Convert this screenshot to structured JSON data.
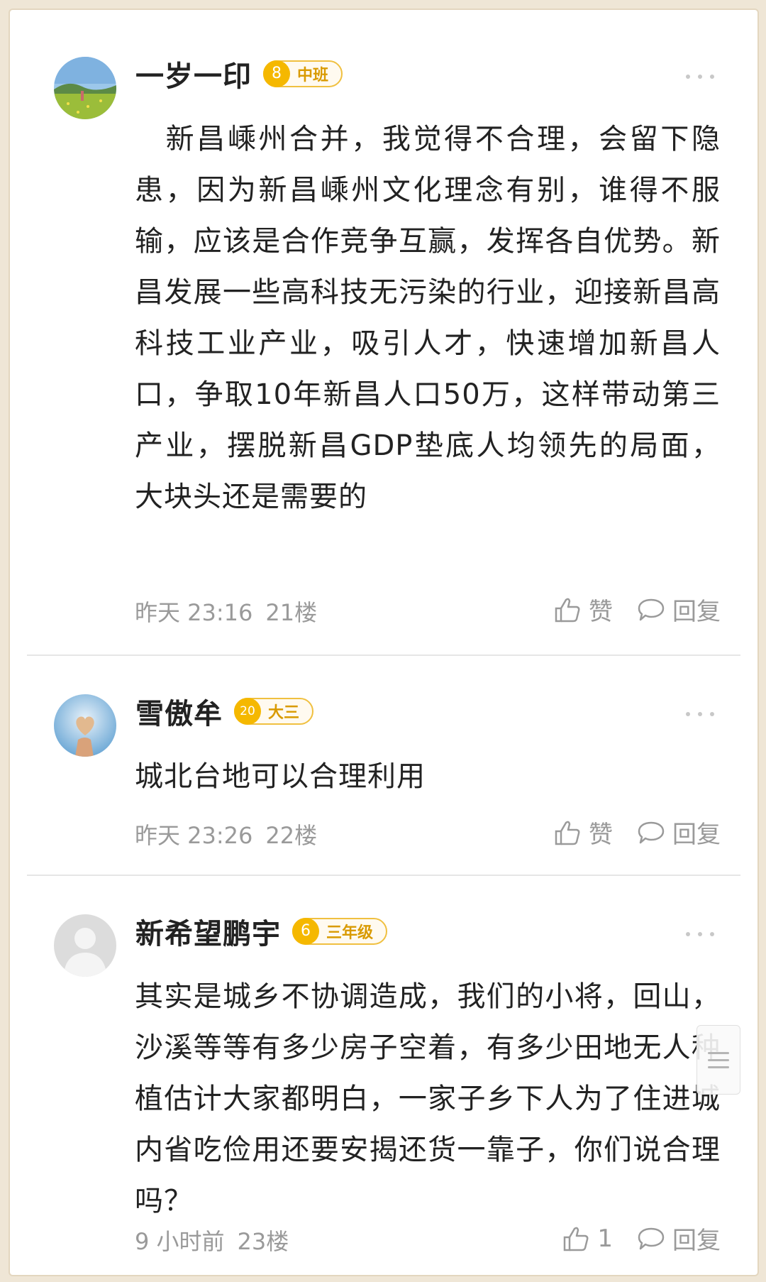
{
  "comments": [
    {
      "username": "一岁一印",
      "badge_level_glyph": "8",
      "badge_label": "中班",
      "text": "　新昌嵊州合并，我觉得不合理，会留下隐患，因为新昌嵊州文化理念有别，谁得不服输，应该是合作竞争互赢，发挥各自优势。新昌发展一些高科技无污染的行业，迎接新昌高科技工业产业，吸引人才，快速增加新昌人口，争取10年新昌人口50万，这样带动第三产业，摆脱新昌GDP垫底人均领先的局面，大块头还是需要的",
      "time": "昨天 23:16",
      "floor": "21楼",
      "like_label": "赞",
      "reply_label": "回复"
    },
    {
      "username": "雪傲牟",
      "badge_level_glyph": "20",
      "badge_label": "大三",
      "text": "城北台地可以合理利用",
      "time": "昨天 23:26",
      "floor": "22楼",
      "like_label": "赞",
      "reply_label": "回复"
    },
    {
      "username": "新希望鹏宇",
      "badge_level_glyph": "6",
      "badge_label": "三年级",
      "text": "其实是城乡不协调造成，我们的小将，回山，沙溪等等有多少房子空着，有多少田地无人种植估计大家都明白，一家子乡下人为了住进城内省吃俭用还要安揭还货一靠子，你们说合理吗？",
      "time": "9 小时前",
      "floor": "23楼",
      "like_label": "1",
      "reply_label": "回复"
    }
  ],
  "icons": {
    "avatar_1": "landscape-avatar-icon",
    "avatar_2": "heart-hand-avatar-icon",
    "avatar_3": "default-user-avatar-icon",
    "badge": "star-badge-icon",
    "more": "more-dots-icon",
    "like": "thumbs-up-icon",
    "reply": "speech-bubble-icon",
    "scroll": "scroll-handle-icon"
  },
  "colors": {
    "badge_gold": "#f5b800",
    "meta_gray": "#9a9a9a",
    "border_beige": "#e3d6bf"
  }
}
